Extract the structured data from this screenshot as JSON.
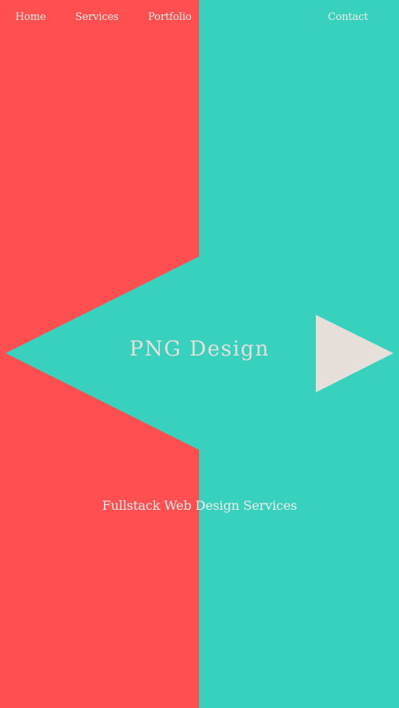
{
  "colors": {
    "left_panel": "#FF4F51",
    "right_panel": "#38D1BE",
    "arrow": "#E6DFDA",
    "text": "#F0EEE8"
  },
  "nav": {
    "items": [
      {
        "label": "Home"
      },
      {
        "label": "Services"
      },
      {
        "label": "Portfolio"
      },
      {
        "label": "Contact"
      }
    ]
  },
  "hero": {
    "title": "PNG Design",
    "subtitle": "Fullstack Web Design Services"
  },
  "icons": {
    "left_shape": "left-pointing-arrow-shape",
    "right_arrow": "play-arrow-icon"
  }
}
